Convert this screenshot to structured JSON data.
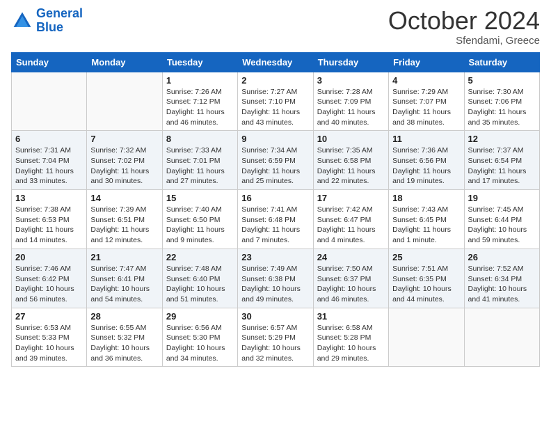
{
  "header": {
    "logo_line1": "General",
    "logo_line2": "Blue",
    "month": "October 2024",
    "location": "Sfendami, Greece"
  },
  "weekdays": [
    "Sunday",
    "Monday",
    "Tuesday",
    "Wednesday",
    "Thursday",
    "Friday",
    "Saturday"
  ],
  "weeks": [
    [
      {
        "day": "",
        "sunrise": "",
        "sunset": "",
        "daylight": ""
      },
      {
        "day": "",
        "sunrise": "",
        "sunset": "",
        "daylight": ""
      },
      {
        "day": "1",
        "sunrise": "Sunrise: 7:26 AM",
        "sunset": "Sunset: 7:12 PM",
        "daylight": "Daylight: 11 hours and 46 minutes."
      },
      {
        "day": "2",
        "sunrise": "Sunrise: 7:27 AM",
        "sunset": "Sunset: 7:10 PM",
        "daylight": "Daylight: 11 hours and 43 minutes."
      },
      {
        "day": "3",
        "sunrise": "Sunrise: 7:28 AM",
        "sunset": "Sunset: 7:09 PM",
        "daylight": "Daylight: 11 hours and 40 minutes."
      },
      {
        "day": "4",
        "sunrise": "Sunrise: 7:29 AM",
        "sunset": "Sunset: 7:07 PM",
        "daylight": "Daylight: 11 hours and 38 minutes."
      },
      {
        "day": "5",
        "sunrise": "Sunrise: 7:30 AM",
        "sunset": "Sunset: 7:06 PM",
        "daylight": "Daylight: 11 hours and 35 minutes."
      }
    ],
    [
      {
        "day": "6",
        "sunrise": "Sunrise: 7:31 AM",
        "sunset": "Sunset: 7:04 PM",
        "daylight": "Daylight: 11 hours and 33 minutes."
      },
      {
        "day": "7",
        "sunrise": "Sunrise: 7:32 AM",
        "sunset": "Sunset: 7:02 PM",
        "daylight": "Daylight: 11 hours and 30 minutes."
      },
      {
        "day": "8",
        "sunrise": "Sunrise: 7:33 AM",
        "sunset": "Sunset: 7:01 PM",
        "daylight": "Daylight: 11 hours and 27 minutes."
      },
      {
        "day": "9",
        "sunrise": "Sunrise: 7:34 AM",
        "sunset": "Sunset: 6:59 PM",
        "daylight": "Daylight: 11 hours and 25 minutes."
      },
      {
        "day": "10",
        "sunrise": "Sunrise: 7:35 AM",
        "sunset": "Sunset: 6:58 PM",
        "daylight": "Daylight: 11 hours and 22 minutes."
      },
      {
        "day": "11",
        "sunrise": "Sunrise: 7:36 AM",
        "sunset": "Sunset: 6:56 PM",
        "daylight": "Daylight: 11 hours and 19 minutes."
      },
      {
        "day": "12",
        "sunrise": "Sunrise: 7:37 AM",
        "sunset": "Sunset: 6:54 PM",
        "daylight": "Daylight: 11 hours and 17 minutes."
      }
    ],
    [
      {
        "day": "13",
        "sunrise": "Sunrise: 7:38 AM",
        "sunset": "Sunset: 6:53 PM",
        "daylight": "Daylight: 11 hours and 14 minutes."
      },
      {
        "day": "14",
        "sunrise": "Sunrise: 7:39 AM",
        "sunset": "Sunset: 6:51 PM",
        "daylight": "Daylight: 11 hours and 12 minutes."
      },
      {
        "day": "15",
        "sunrise": "Sunrise: 7:40 AM",
        "sunset": "Sunset: 6:50 PM",
        "daylight": "Daylight: 11 hours and 9 minutes."
      },
      {
        "day": "16",
        "sunrise": "Sunrise: 7:41 AM",
        "sunset": "Sunset: 6:48 PM",
        "daylight": "Daylight: 11 hours and 7 minutes."
      },
      {
        "day": "17",
        "sunrise": "Sunrise: 7:42 AM",
        "sunset": "Sunset: 6:47 PM",
        "daylight": "Daylight: 11 hours and 4 minutes."
      },
      {
        "day": "18",
        "sunrise": "Sunrise: 7:43 AM",
        "sunset": "Sunset: 6:45 PM",
        "daylight": "Daylight: 11 hours and 1 minute."
      },
      {
        "day": "19",
        "sunrise": "Sunrise: 7:45 AM",
        "sunset": "Sunset: 6:44 PM",
        "daylight": "Daylight: 10 hours and 59 minutes."
      }
    ],
    [
      {
        "day": "20",
        "sunrise": "Sunrise: 7:46 AM",
        "sunset": "Sunset: 6:42 PM",
        "daylight": "Daylight: 10 hours and 56 minutes."
      },
      {
        "day": "21",
        "sunrise": "Sunrise: 7:47 AM",
        "sunset": "Sunset: 6:41 PM",
        "daylight": "Daylight: 10 hours and 54 minutes."
      },
      {
        "day": "22",
        "sunrise": "Sunrise: 7:48 AM",
        "sunset": "Sunset: 6:40 PM",
        "daylight": "Daylight: 10 hours and 51 minutes."
      },
      {
        "day": "23",
        "sunrise": "Sunrise: 7:49 AM",
        "sunset": "Sunset: 6:38 PM",
        "daylight": "Daylight: 10 hours and 49 minutes."
      },
      {
        "day": "24",
        "sunrise": "Sunrise: 7:50 AM",
        "sunset": "Sunset: 6:37 PM",
        "daylight": "Daylight: 10 hours and 46 minutes."
      },
      {
        "day": "25",
        "sunrise": "Sunrise: 7:51 AM",
        "sunset": "Sunset: 6:35 PM",
        "daylight": "Daylight: 10 hours and 44 minutes."
      },
      {
        "day": "26",
        "sunrise": "Sunrise: 7:52 AM",
        "sunset": "Sunset: 6:34 PM",
        "daylight": "Daylight: 10 hours and 41 minutes."
      }
    ],
    [
      {
        "day": "27",
        "sunrise": "Sunrise: 6:53 AM",
        "sunset": "Sunset: 5:33 PM",
        "daylight": "Daylight: 10 hours and 39 minutes."
      },
      {
        "day": "28",
        "sunrise": "Sunrise: 6:55 AM",
        "sunset": "Sunset: 5:32 PM",
        "daylight": "Daylight: 10 hours and 36 minutes."
      },
      {
        "day": "29",
        "sunrise": "Sunrise: 6:56 AM",
        "sunset": "Sunset: 5:30 PM",
        "daylight": "Daylight: 10 hours and 34 minutes."
      },
      {
        "day": "30",
        "sunrise": "Sunrise: 6:57 AM",
        "sunset": "Sunset: 5:29 PM",
        "daylight": "Daylight: 10 hours and 32 minutes."
      },
      {
        "day": "31",
        "sunrise": "Sunrise: 6:58 AM",
        "sunset": "Sunset: 5:28 PM",
        "daylight": "Daylight: 10 hours and 29 minutes."
      },
      {
        "day": "",
        "sunrise": "",
        "sunset": "",
        "daylight": ""
      },
      {
        "day": "",
        "sunrise": "",
        "sunset": "",
        "daylight": ""
      }
    ]
  ]
}
